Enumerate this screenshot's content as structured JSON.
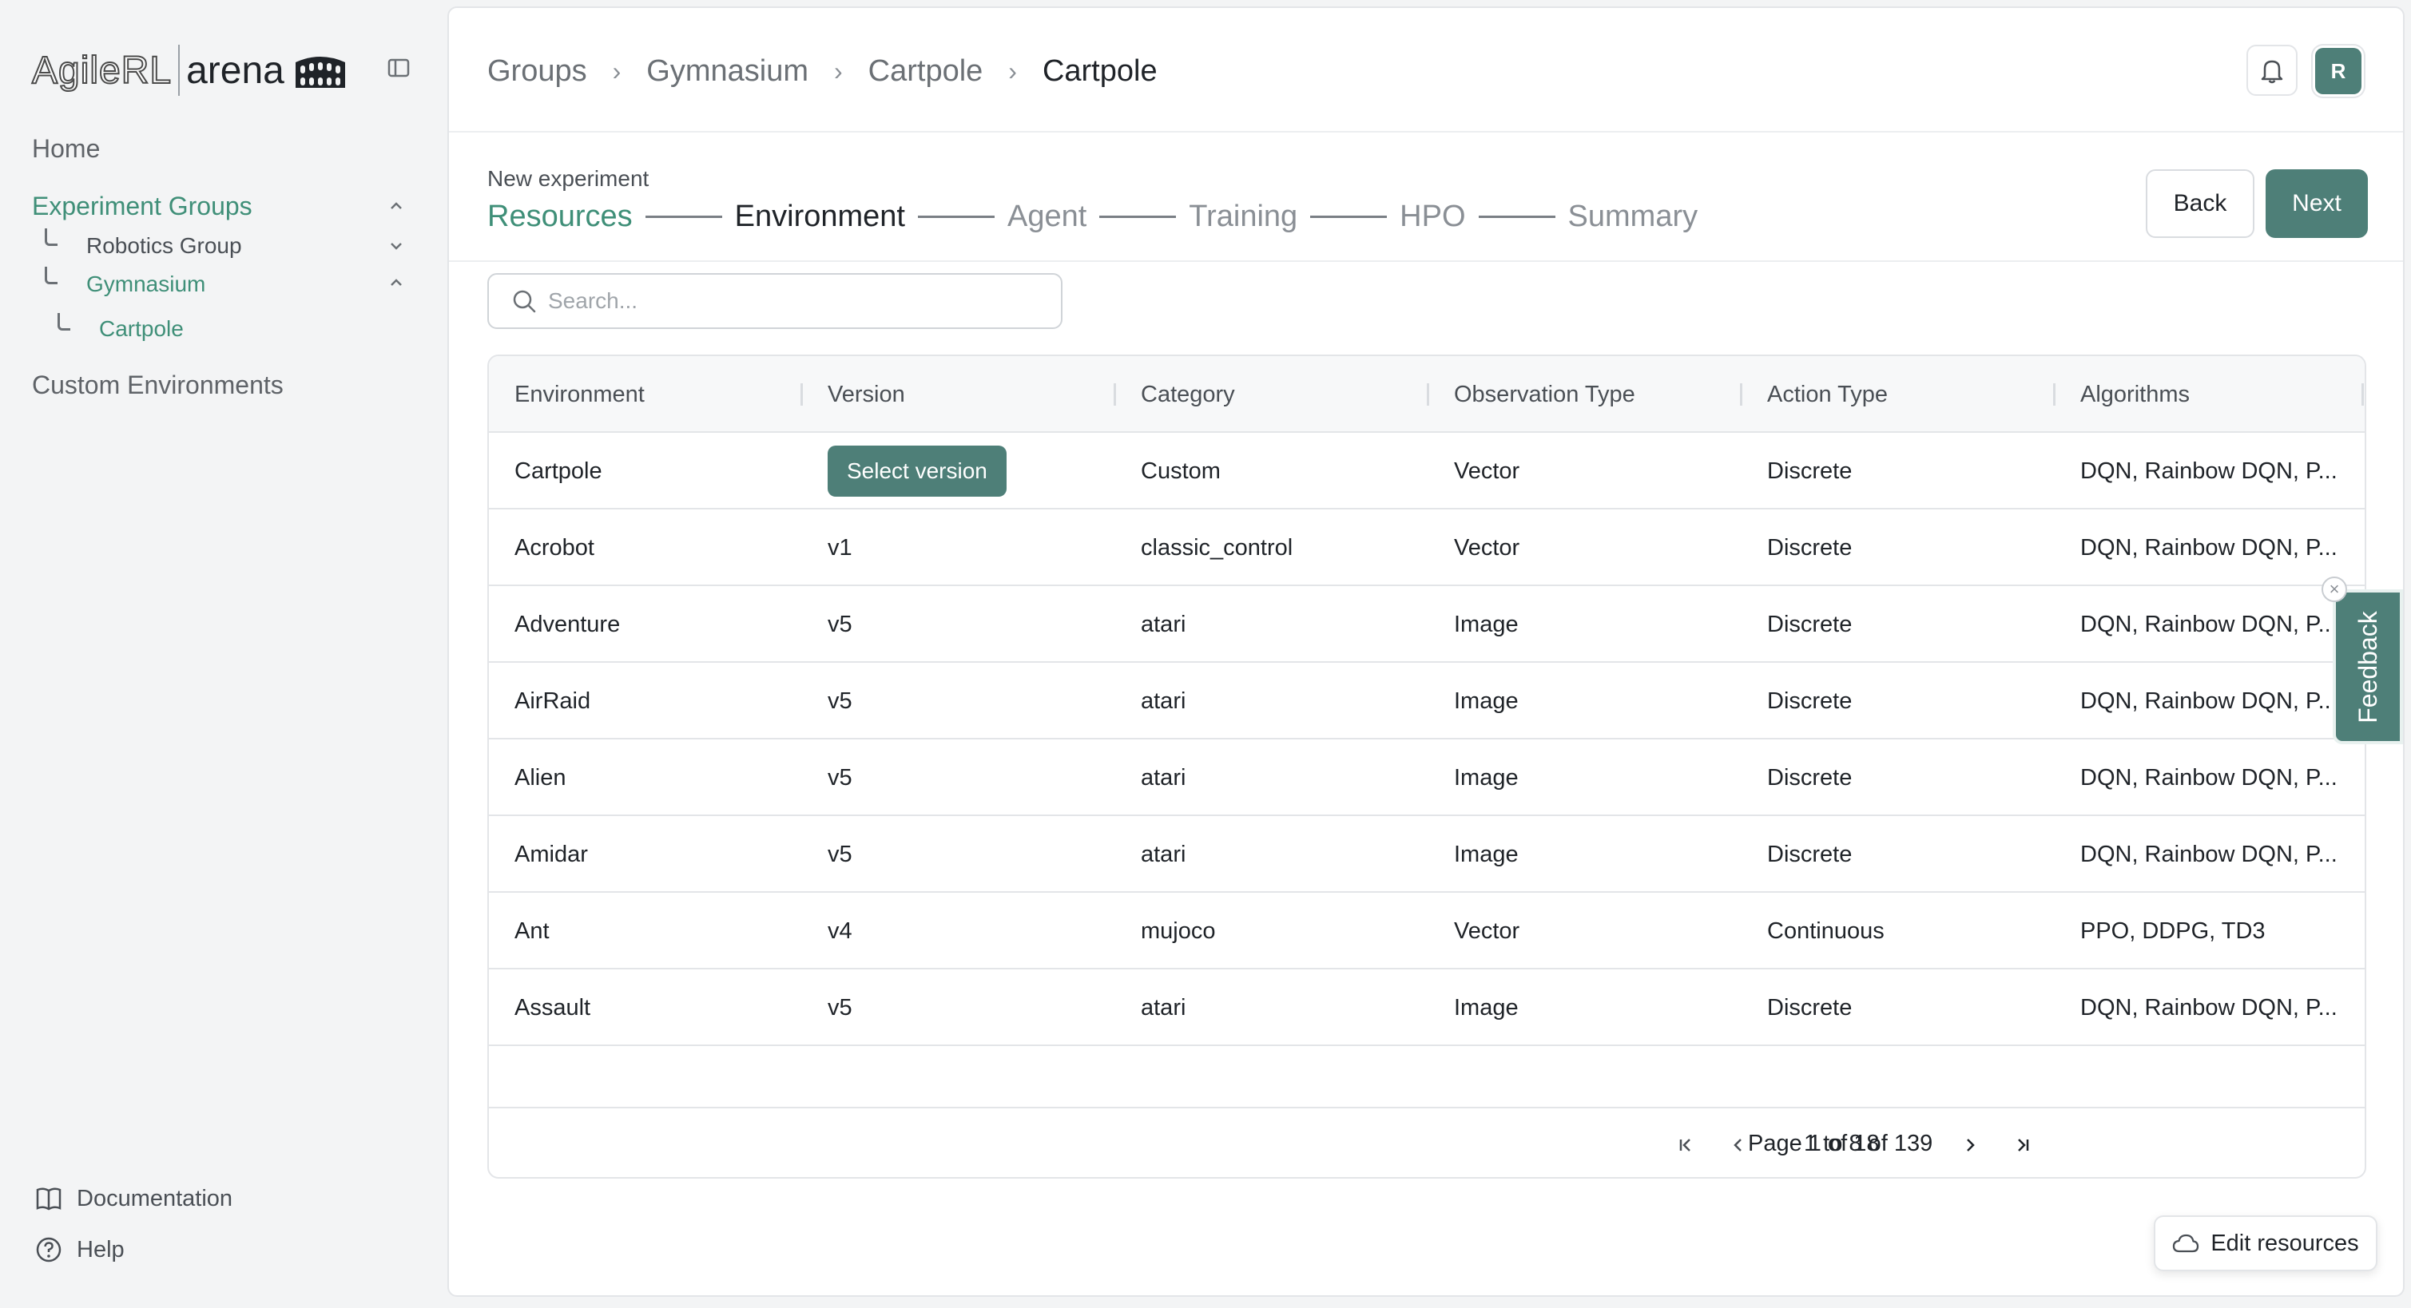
{
  "app": {
    "logo_left": "AgileRL",
    "logo_right": "arena"
  },
  "sidebar": {
    "home": "Home",
    "experiment_groups": "Experiment Groups",
    "groups": [
      {
        "label": "Robotics Group"
      },
      {
        "label": "Gymnasium"
      }
    ],
    "experiment": "Cartpole",
    "custom_envs": "Custom Environments",
    "documentation": "Documentation",
    "help": "Help"
  },
  "header": {
    "breadcrumbs": [
      "Groups",
      "Gymnasium",
      "Cartpole",
      "Cartpole"
    ],
    "avatar_initial": "R"
  },
  "wizard": {
    "subtitle": "New experiment",
    "steps": [
      "Resources",
      "Environment",
      "Agent",
      "Training",
      "HPO",
      "Summary"
    ],
    "completed_step": "Resources",
    "active_step": "Environment",
    "back_label": "Back",
    "next_label": "Next"
  },
  "search": {
    "placeholder": "Search...",
    "value": ""
  },
  "table": {
    "columns": [
      "Environment",
      "Version",
      "Category",
      "Observation Type",
      "Action Type",
      "Algorithms"
    ],
    "select_version_label": "Select version",
    "rows": [
      {
        "environment": "Cartpole",
        "version": "",
        "category": "Custom",
        "observation": "Vector",
        "action": "Discrete",
        "algorithms": "DQN, Rainbow DQN, P..."
      },
      {
        "environment": "Acrobot",
        "version": "v1",
        "category": "classic_control",
        "observation": "Vector",
        "action": "Discrete",
        "algorithms": "DQN, Rainbow DQN, P..."
      },
      {
        "environment": "Adventure",
        "version": "v5",
        "category": "atari",
        "observation": "Image",
        "action": "Discrete",
        "algorithms": "DQN, Rainbow DQN, P..."
      },
      {
        "environment": "AirRaid",
        "version": "v5",
        "category": "atari",
        "observation": "Image",
        "action": "Discrete",
        "algorithms": "DQN, Rainbow DQN, P..."
      },
      {
        "environment": "Alien",
        "version": "v5",
        "category": "atari",
        "observation": "Image",
        "action": "Discrete",
        "algorithms": "DQN, Rainbow DQN, P..."
      },
      {
        "environment": "Amidar",
        "version": "v5",
        "category": "atari",
        "observation": "Image",
        "action": "Discrete",
        "algorithms": "DQN, Rainbow DQN, P..."
      },
      {
        "environment": "Ant",
        "version": "v4",
        "category": "mujoco",
        "observation": "Vector",
        "action": "Continuous",
        "algorithms": "PPO, DDPG, TD3"
      },
      {
        "environment": "Assault",
        "version": "v5",
        "category": "atari",
        "observation": "Image",
        "action": "Discrete",
        "algorithms": "DQN, Rainbow DQN, P..."
      }
    ],
    "pagination": {
      "summary": "1 to 8 of 139",
      "page": "Page 1 of 18"
    }
  },
  "floating": {
    "edit_resources": "Edit resources",
    "feedback": "Feedback"
  },
  "colors": {
    "accent": "#4e7f78",
    "active_nav": "#3f8f78"
  },
  "icons": [
    "colosseum-icon",
    "sidebar-collapse-icon",
    "chevron-up-icon",
    "chevron-down-icon",
    "book-icon",
    "help-icon",
    "bell-icon",
    "search-icon",
    "first-page-icon",
    "prev-page-icon",
    "next-page-icon",
    "last-page-icon",
    "cloud-icon",
    "close-icon"
  ]
}
